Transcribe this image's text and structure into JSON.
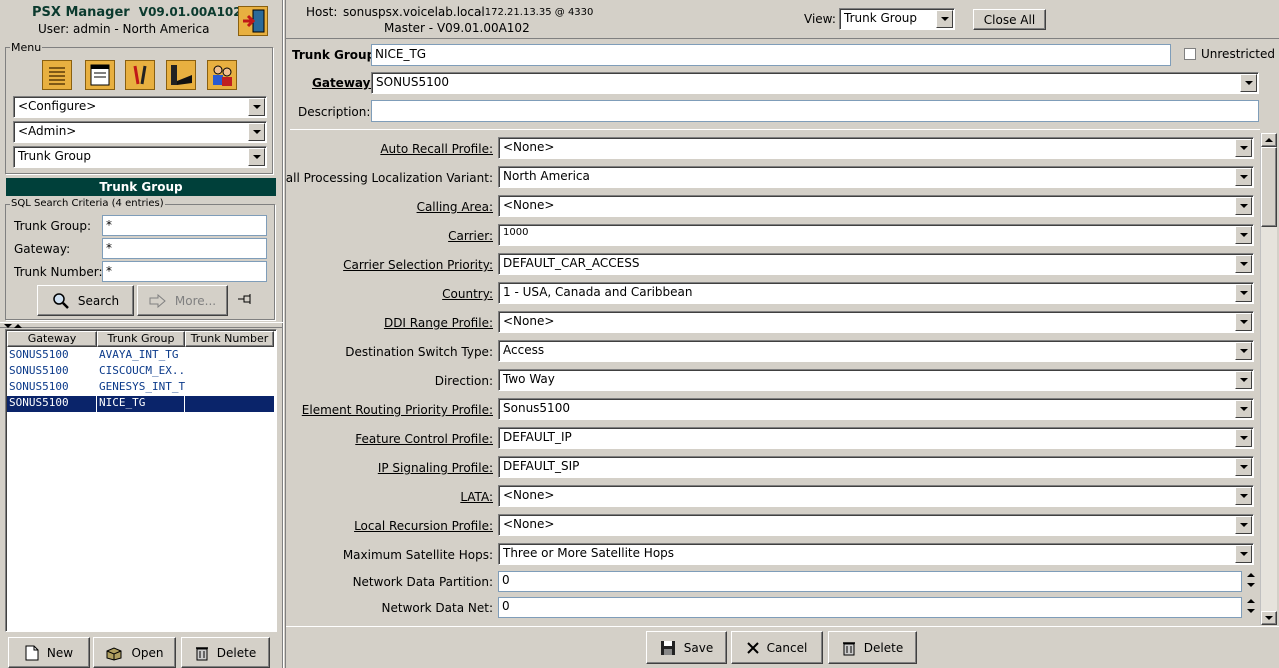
{
  "app": {
    "title": "PSX Manager",
    "version": "V09.01.00A102",
    "user_line": "User:  admin - North America"
  },
  "header": {
    "host_label": "Host:",
    "host_value": "sonuspsx.voicelab.local",
    "host_ip": "- 172.21.13.35 @ 4330",
    "master_line": "Master - V09.01.00A102",
    "view_label": "View:",
    "view_value": "Trunk Group",
    "close_all": "Close All"
  },
  "menu": {
    "title": "Menu",
    "icons": [
      "list-icon",
      "form-icon",
      "tools-icon",
      "device-icon",
      "users-icon"
    ],
    "configure": "<Configure>",
    "admin": "<Admin>",
    "object": "Trunk Group"
  },
  "left_panel": {
    "title": "Trunk Group",
    "criteria_title": "SQL Search Criteria (4 entries)",
    "fields": [
      {
        "label": "Trunk Group:",
        "value": "*"
      },
      {
        "label": "Gateway:",
        "value": "*"
      },
      {
        "label": "Trunk Number:",
        "value": "*"
      }
    ],
    "search": "Search",
    "more": "More...",
    "columns": [
      "Gateway",
      "Trunk Group",
      "Trunk Number"
    ],
    "rows": [
      {
        "gateway": "SONUS5100",
        "trunk_group": "AVAYA_INT_TG",
        "trunk_number": ""
      },
      {
        "gateway": "SONUS5100",
        "trunk_group": "CISCOUCM_EX...",
        "trunk_number": ""
      },
      {
        "gateway": "SONUS5100",
        "trunk_group": "GENESYS_INT_TG",
        "trunk_number": ""
      },
      {
        "gateway": "SONUS5100",
        "trunk_group": "NICE_TG",
        "trunk_number": ""
      }
    ],
    "selected_row": 3,
    "new": "New",
    "open": "Open",
    "delete": "Delete"
  },
  "form": {
    "trunk_group_label": "Trunk Group:",
    "trunk_group_value": "NICE_TG",
    "unrestricted_label": "Unrestricted",
    "gateway_label": "Gateway:",
    "gateway_value": "SONUS5100",
    "description_label": "Description:",
    "description_value": "",
    "rows": [
      {
        "label": "Auto Recall Profile:",
        "value": "<None>",
        "link": true
      },
      {
        "label": "Call Processing Localization Variant:",
        "value": "North America",
        "link": false
      },
      {
        "label": "Calling Area:",
        "value": "<None>",
        "link": true
      },
      {
        "label": "Carrier:",
        "value": "1000",
        "link": true
      },
      {
        "label": "Carrier Selection Priority:",
        "value": "DEFAULT_CAR_ACCESS",
        "link": true
      },
      {
        "label": "Country:",
        "value": "1 - USA, Canada and Caribbean",
        "link": true
      },
      {
        "label": "DDI Range Profile:",
        "value": "<None>",
        "link": true
      },
      {
        "label": "Destination Switch Type:",
        "value": "Access",
        "link": false
      },
      {
        "label": "Direction:",
        "value": "Two Way",
        "link": false
      },
      {
        "label": "Element Routing Priority Profile:",
        "value": "Sonus5100",
        "link": true
      },
      {
        "label": "Feature Control Profile:",
        "value": "DEFAULT_IP",
        "link": true
      },
      {
        "label": "IP Signaling Profile:",
        "value": "DEFAULT_SIP",
        "link": true
      },
      {
        "label": "LATA:",
        "value": "<None>",
        "link": true
      },
      {
        "label": "Local Recursion Profile:",
        "value": "<None>",
        "link": true
      },
      {
        "label": "Maximum Satellite Hops:",
        "value": "Three or More Satellite Hops",
        "link": false
      }
    ],
    "spin_rows": [
      {
        "label": "Network Data Partition:",
        "value": "0"
      },
      {
        "label": "Network Data Net:",
        "value": "0"
      }
    ],
    "save": "Save",
    "cancel": "Cancel",
    "delete": "Delete"
  }
}
